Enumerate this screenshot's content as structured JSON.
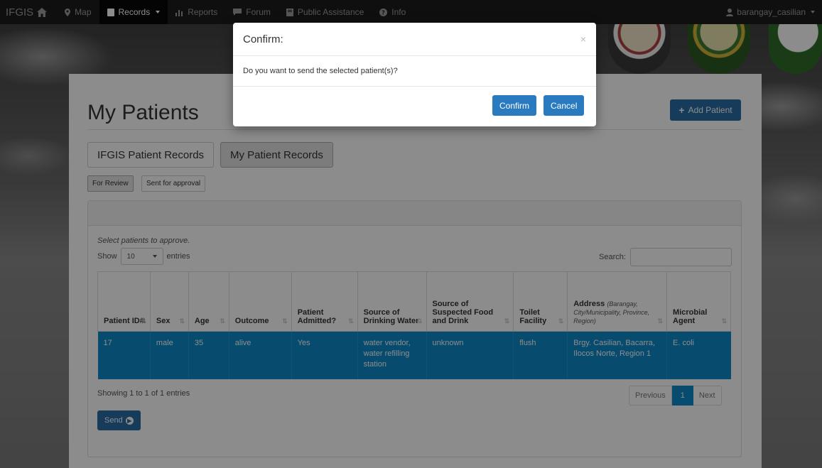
{
  "navbar": {
    "brand": "IFGIS",
    "items": [
      {
        "label": "Map",
        "icon": "map-marker-icon"
      },
      {
        "label": "Records",
        "icon": "file-icon",
        "active": true
      },
      {
        "label": "Reports",
        "icon": "bar-chart-icon"
      },
      {
        "label": "Forum",
        "icon": "comment-icon"
      },
      {
        "label": "Public Assistance",
        "icon": "book-icon"
      },
      {
        "label": "Info",
        "icon": "question-circle-icon"
      }
    ],
    "user": "barangay_casilian"
  },
  "page": {
    "title": "My Patients",
    "add_button": "Add Patient",
    "tabs": [
      "IFGIS Patient Records",
      "My Patient Records"
    ],
    "subtabs": [
      "For Review",
      "Sent for approval"
    ],
    "hint": "Select patients to approve.",
    "show_prefix": "Show",
    "show_value": "10",
    "show_suffix": "entries",
    "search_label": "Search:"
  },
  "table": {
    "headers": [
      {
        "label": "Patient ID#"
      },
      {
        "label": "Sex"
      },
      {
        "label": "Age"
      },
      {
        "label": "Outcome"
      },
      {
        "label": "Patient Admitted?"
      },
      {
        "label": "Source of Drinking Water"
      },
      {
        "label": "Source of Suspected Food and Drink"
      },
      {
        "label": "Toilet Facility"
      },
      {
        "label": "Address",
        "sub": "(Barangay, City/Municipality, Province, Region)"
      },
      {
        "label": "Microbial Agent"
      }
    ],
    "rows": [
      [
        "17",
        "male",
        "35",
        "alive",
        "Yes",
        "water vendor, water refilling station",
        "unknown",
        "flush",
        "Brgy. Casilian, Bacarra, Ilocos Norte, Region 1",
        "E. coli"
      ]
    ],
    "info": "Showing 1 to 1 of 1 entries",
    "pager": {
      "prev": "Previous",
      "current": "1",
      "next": "Next"
    },
    "send_button": "Send"
  },
  "modal": {
    "title": "Confirm:",
    "close": "×",
    "message": "Do you want to send the selected patient(s)?",
    "confirm": "Confirm",
    "cancel": "Cancel"
  },
  "colors": {
    "navbar": "#1d1d1d",
    "primary": "#2a6da6",
    "selected_row": "#0e8ac8",
    "modal_button": "#2a7ac0"
  }
}
